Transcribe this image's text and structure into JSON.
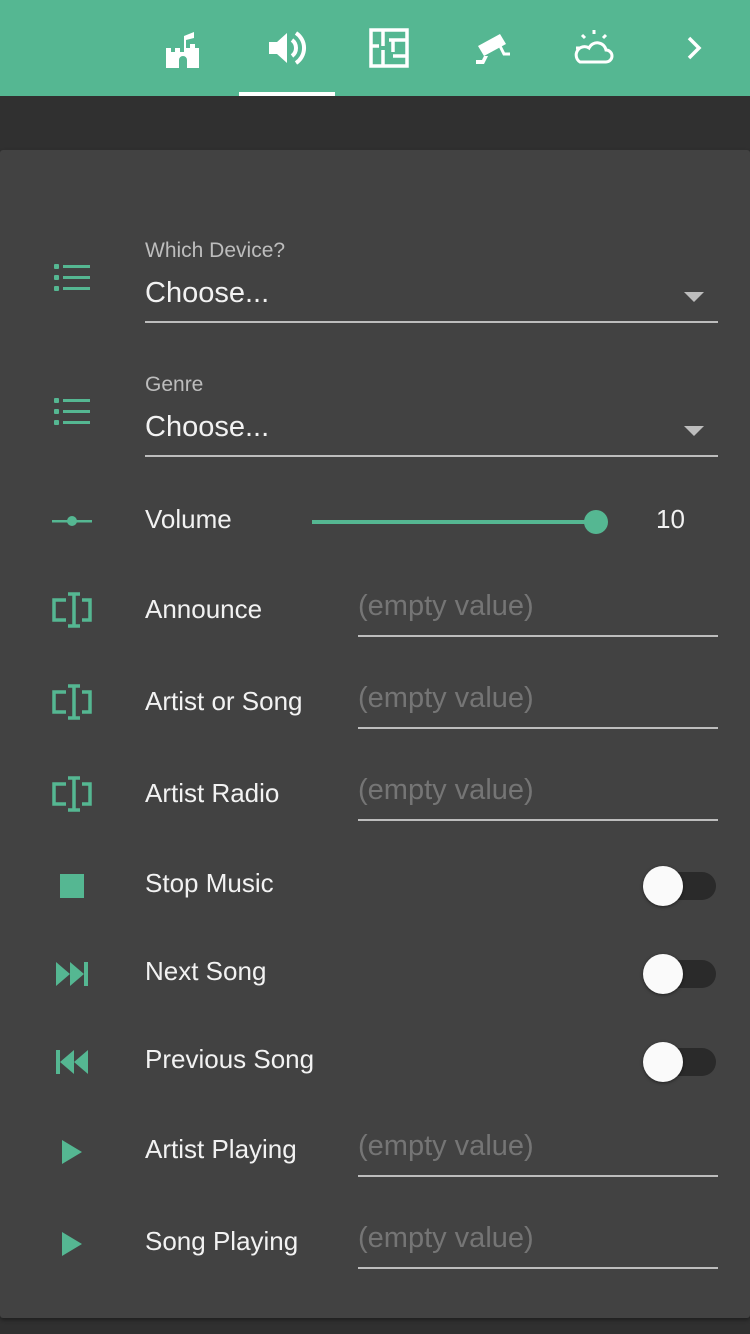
{
  "topbar": {
    "tabs": [
      {
        "icon": "castle-icon"
      },
      {
        "icon": "volume-icon",
        "active": true
      },
      {
        "icon": "floor-plan-icon"
      },
      {
        "icon": "cctv-icon"
      },
      {
        "icon": "weather-partly-cloudy-icon"
      },
      {
        "icon": "chevron-right-icon"
      }
    ]
  },
  "colors": {
    "accent": "#55b792",
    "background": "#303030",
    "card": "#424242"
  },
  "device_select": {
    "label": "Which Device?",
    "value": "Choose..."
  },
  "genre_select": {
    "label": "Genre",
    "value": "Choose..."
  },
  "volume": {
    "label": "Volume",
    "value": "10",
    "min": 0,
    "max": 10
  },
  "announce": {
    "label": "Announce",
    "placeholder": "(empty value)"
  },
  "artist_or_song": {
    "label": "Artist or Song",
    "placeholder": "(empty value)"
  },
  "artist_radio": {
    "label": "Artist Radio",
    "placeholder": "(empty value)"
  },
  "stop_music": {
    "label": "Stop Music",
    "on": false
  },
  "next_song": {
    "label": "Next Song",
    "on": false
  },
  "previous_song": {
    "label": "Previous Song",
    "on": false
  },
  "artist_playing": {
    "label": "Artist Playing",
    "placeholder": "(empty value)"
  },
  "song_playing": {
    "label": "Song Playing",
    "placeholder": "(empty value)"
  }
}
